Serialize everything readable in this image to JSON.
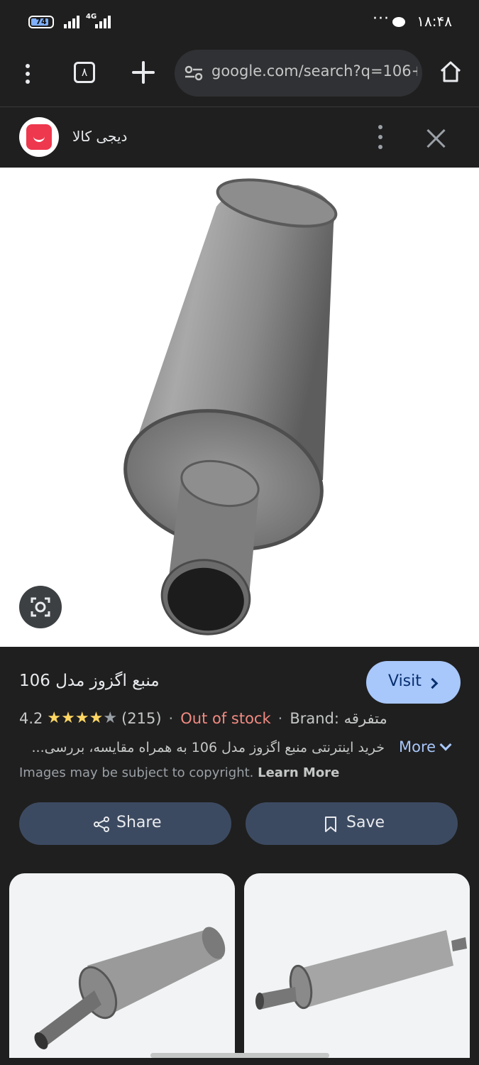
{
  "status_bar": {
    "battery": "74",
    "network": "4G",
    "time": "۱۸:۴۸"
  },
  "browser": {
    "tab_count": "۸",
    "url": "google.com/search?q=106+"
  },
  "site": {
    "name": "دیجی کالا"
  },
  "result": {
    "title": "منبع اگزوز مدل 106",
    "visit_label": "Visit",
    "rating": "4.2",
    "stars_filled": 4,
    "reviews": "(215)",
    "stock": "Out of stock",
    "brand": "Brand: متفرقه",
    "description": "خرید اینترنتی منبع اگزوز مدل 106 به همراه مقایسه، بررسی...",
    "more_label": "More",
    "copyright": "Images may be subject to copyright.",
    "learn_more": "Learn More",
    "share_label": "Share",
    "save_label": "Save"
  },
  "colors": {
    "accent": "#a8c7fa",
    "out_of_stock": "#f28b82",
    "star": "#fdd663",
    "brand_red": "#ee384e"
  }
}
